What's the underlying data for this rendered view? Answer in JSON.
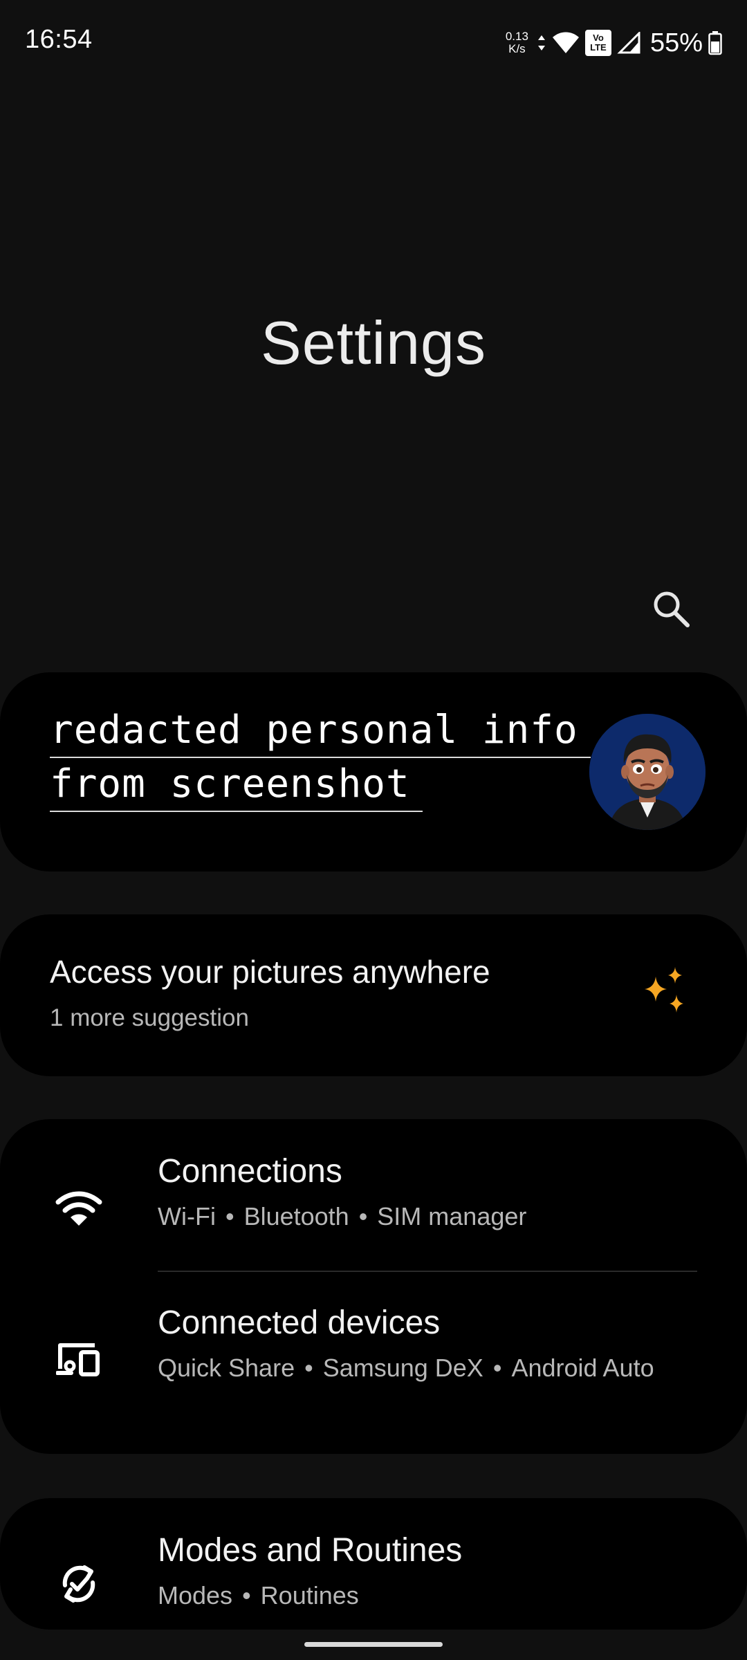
{
  "status_bar": {
    "time": "16:54",
    "net_speed_value": "0.13",
    "net_speed_unit": "K/s",
    "lte_label_top": "Vo",
    "lte_label_bottom": "LTE",
    "battery": "55%",
    "icons": [
      "data-arrows-icon",
      "wifi-icon",
      "volte-icon",
      "signal-icon",
      "battery-icon"
    ]
  },
  "header": {
    "title": "Settings",
    "search_icon": "search-icon"
  },
  "profile_card": {
    "line1": "redacted personal info",
    "line2": "from screenshot",
    "avatar_icon": "avatar"
  },
  "suggestion_card": {
    "title": "Access your pictures anywhere",
    "subtitle": "1 more suggestion",
    "icon": "sparkle-icon",
    "accent": "#f5a623"
  },
  "settings_groups": [
    {
      "items": [
        {
          "title": "Connections",
          "icon": "wifi-icon",
          "sub": [
            "Wi-Fi",
            "Bluetooth",
            "SIM manager"
          ]
        },
        {
          "title": "Connected devices",
          "icon": "connected-devices-icon",
          "sub": [
            "Quick Share",
            "Samsung DeX",
            "Android Auto"
          ]
        }
      ]
    },
    {
      "items": [
        {
          "title": "Modes and Routines",
          "icon": "modes-routines-icon",
          "sub": [
            "Modes",
            "Routines"
          ]
        }
      ]
    }
  ],
  "separator": "•",
  "colors": {
    "background": "#101010",
    "card": "#000000",
    "primary_text": "#f2f2f2",
    "secondary_text": "#b8b8b8"
  }
}
